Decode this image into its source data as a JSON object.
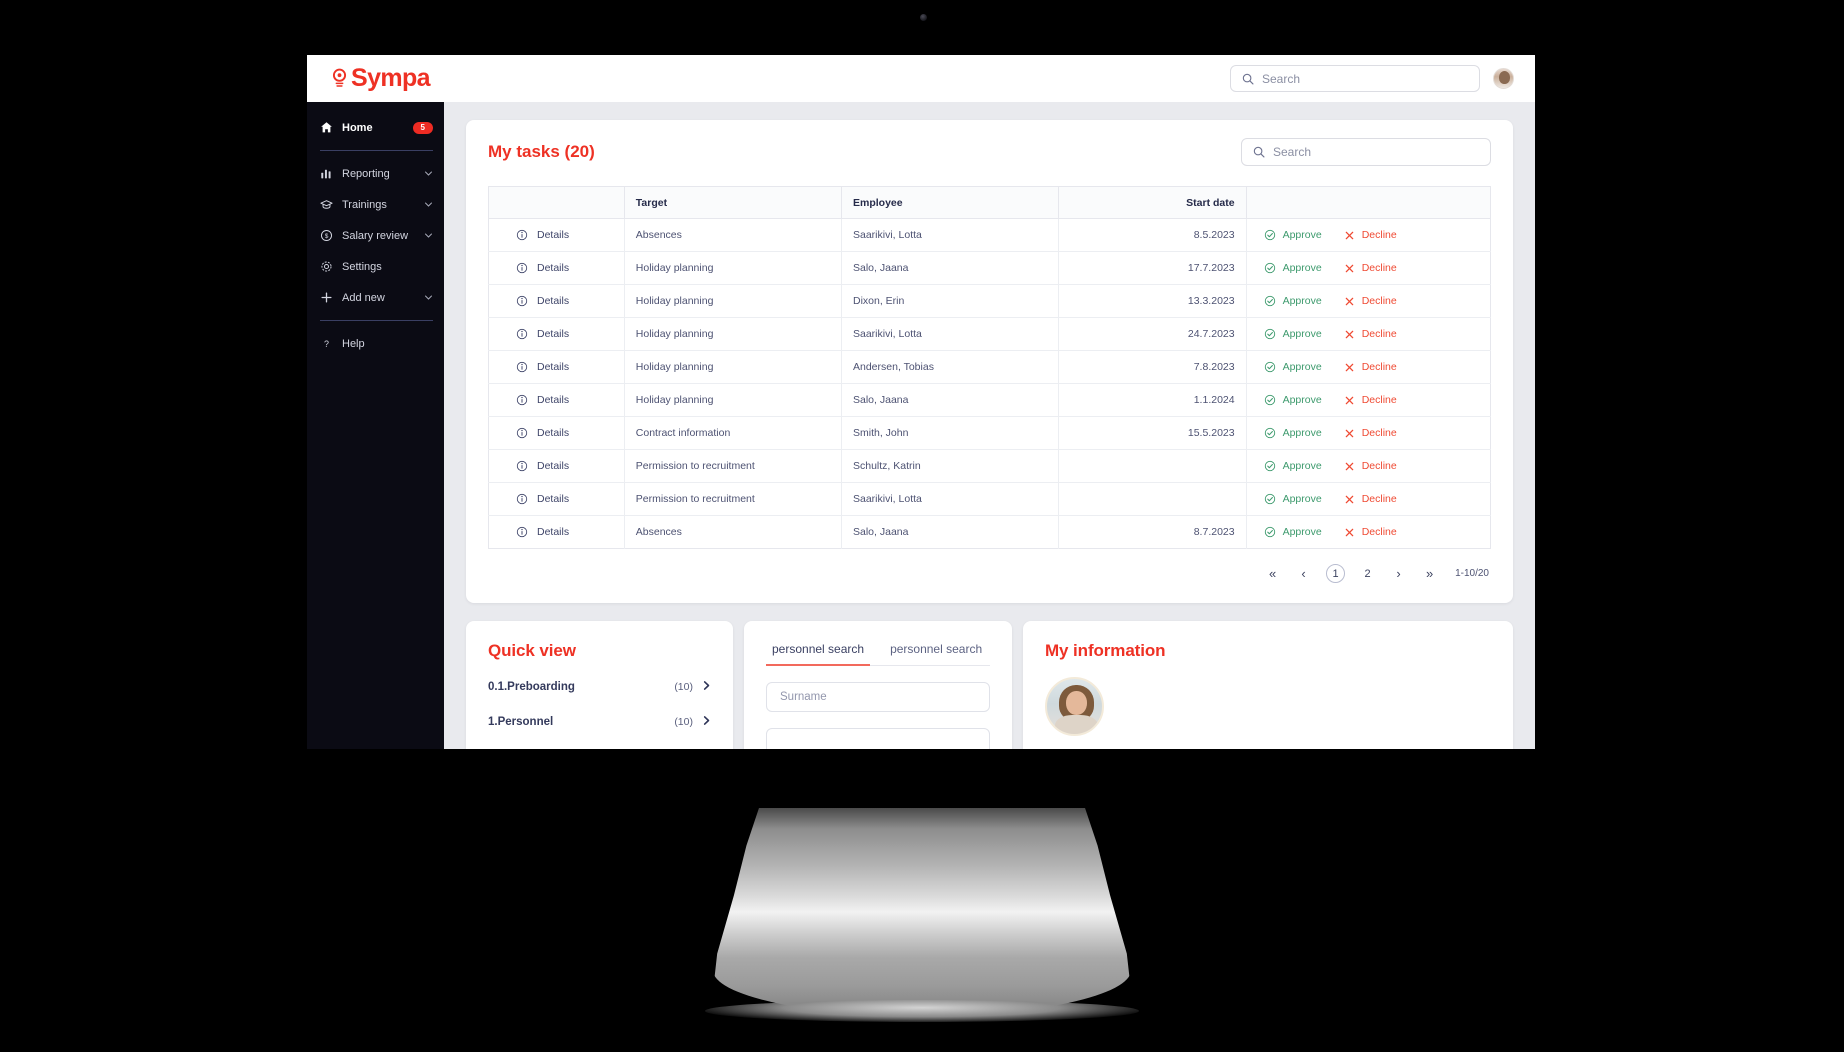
{
  "brand": {
    "name": "Sympa",
    "icon": "lightbulb-icon",
    "color": "#ee3124"
  },
  "topbar": {
    "search_placeholder": "Search",
    "search_value": "",
    "search_icon": "search-icon",
    "avatar": "user-avatar"
  },
  "sidebar": {
    "items": [
      {
        "label": "Home",
        "icon": "home-icon",
        "badge": "5",
        "expandable": false,
        "active": true
      },
      {
        "label": "Reporting",
        "icon": "bar-chart-icon",
        "badge": null,
        "expandable": true,
        "active": false
      },
      {
        "label": "Trainings",
        "icon": "graduation-cap-icon",
        "badge": null,
        "expandable": true,
        "active": false
      },
      {
        "label": "Salary review",
        "icon": "dollar-circle-icon",
        "badge": null,
        "expandable": true,
        "active": false
      },
      {
        "label": "Settings",
        "icon": "gear-icon",
        "badge": null,
        "expandable": false,
        "active": false
      },
      {
        "label": "Add new",
        "icon": "plus-icon",
        "badge": null,
        "expandable": true,
        "active": false
      },
      {
        "label": "Help",
        "icon": "question-mark-icon",
        "badge": null,
        "expandable": false,
        "active": false
      }
    ]
  },
  "tasks": {
    "title": "My tasks (20)",
    "search_placeholder": "Search",
    "search_value": "",
    "columns": [
      "",
      "Target",
      "Employee",
      "Start date",
      ""
    ],
    "details_label": "Details",
    "approve_label": "Approve",
    "decline_label": "Decline",
    "rows": [
      {
        "target": "Absences",
        "employee": "Saarikivi, Lotta",
        "start_date": "8.5.2023"
      },
      {
        "target": "Holiday planning",
        "employee": "Salo, Jaana",
        "start_date": "17.7.2023"
      },
      {
        "target": "Holiday planning",
        "employee": "Dixon, Erin",
        "start_date": "13.3.2023"
      },
      {
        "target": "Holiday planning",
        "employee": "Saarikivi, Lotta",
        "start_date": "24.7.2023"
      },
      {
        "target": "Holiday planning",
        "employee": "Andersen, Tobias",
        "start_date": "7.8.2023"
      },
      {
        "target": "Holiday planning",
        "employee": "Salo, Jaana",
        "start_date": "1.1.2024"
      },
      {
        "target": "Contract information",
        "employee": "Smith, John",
        "start_date": "15.5.2023"
      },
      {
        "target": "Permission to recruitment",
        "employee": "Schultz, Katrin",
        "start_date": ""
      },
      {
        "target": "Permission to recruitment",
        "employee": "Saarikivi, Lotta",
        "start_date": ""
      },
      {
        "target": "Absences",
        "employee": "Salo, Jaana",
        "start_date": "8.7.2023"
      }
    ],
    "pagination": {
      "first": "«",
      "prev": "‹",
      "pages": [
        "1",
        "2"
      ],
      "current_page": "1",
      "next": "›",
      "last": "»",
      "range": "1-10/20"
    }
  },
  "quickview": {
    "title": "Quick view",
    "items": [
      {
        "label": "0.1.Preboarding",
        "count": "(10)"
      },
      {
        "label": "1.Personnel",
        "count": "(10)"
      }
    ]
  },
  "personnel_search": {
    "tabs": [
      {
        "label": "personnel search",
        "active": true
      },
      {
        "label": "personnel search",
        "active": false
      }
    ],
    "fields": [
      {
        "placeholder": "Surname",
        "value": ""
      },
      {
        "placeholder": "",
        "value": ""
      }
    ]
  },
  "my_information": {
    "title": "My information",
    "avatar": "employee-photo"
  }
}
